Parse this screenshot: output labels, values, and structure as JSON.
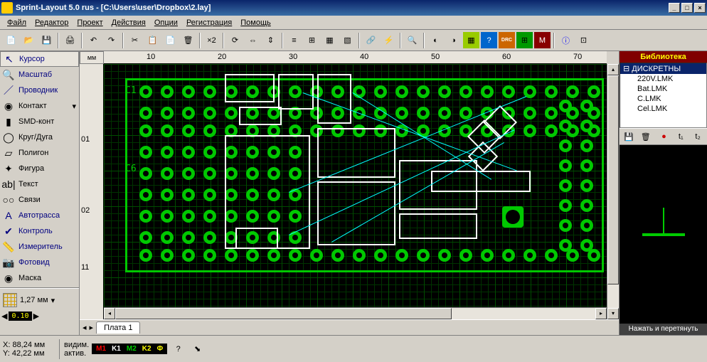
{
  "window": {
    "title": "Sprint-Layout 5.0 rus    - [C:\\Users\\user\\Dropbox\\2.lay]",
    "min": "_",
    "max": "□",
    "close": "×"
  },
  "menu": [
    "Файл",
    "Редактор",
    "Проект",
    "Действия",
    "Опции",
    "Регистрация",
    "Помощь"
  ],
  "tools": [
    {
      "id": "cursor",
      "label": "Курсор",
      "icon": "↖",
      "active": true,
      "navy": true
    },
    {
      "id": "zoom",
      "label": "Масштаб",
      "icon": "🔍",
      "navy": true
    },
    {
      "id": "track",
      "label": "Проводник",
      "icon": "／",
      "navy": true
    },
    {
      "id": "pad",
      "label": "Контакт",
      "icon": "◉",
      "arrow": true
    },
    {
      "id": "smd",
      "label": "SMD-конт",
      "icon": "▮"
    },
    {
      "id": "circle",
      "label": "Круг/Дуга",
      "icon": "◯"
    },
    {
      "id": "poly",
      "label": "Полигон",
      "icon": "▱"
    },
    {
      "id": "shape",
      "label": "Фигура",
      "icon": "✦"
    },
    {
      "id": "text",
      "label": "Текст",
      "icon": "ab|"
    },
    {
      "id": "conn",
      "label": "Связи",
      "icon": "○○"
    },
    {
      "id": "auto",
      "label": "Автотрасса",
      "icon": "A",
      "navy": true
    },
    {
      "id": "check",
      "label": "Контроль",
      "icon": "✔",
      "navy": true
    },
    {
      "id": "meas",
      "label": "Измеритель",
      "icon": "📏",
      "navy": true
    },
    {
      "id": "photo",
      "label": "Фотовид",
      "icon": "📷",
      "navy": true
    },
    {
      "id": "mask",
      "label": "Маска",
      "icon": "◉"
    }
  ],
  "grid": {
    "value": "1,27 мм"
  },
  "zoom": {
    "value": "0.10"
  },
  "ruler": {
    "unit": "мм",
    "hmarks": [
      "10",
      "20",
      "30",
      "40",
      "50",
      "60",
      "70"
    ],
    "vmarks": [
      "01",
      "02",
      "11"
    ]
  },
  "labels": {
    "c1": "C1",
    "c6": "C6"
  },
  "tab": "Плата 1",
  "library": {
    "title": "Библиотека",
    "root": "ДИСКРЕТНЫ",
    "items": [
      "220V.LMK",
      "Bat.LMK",
      "C.LMK",
      "Cel.LMK"
    ]
  },
  "preview_hint": "Нажать и перетянуть",
  "status": {
    "x": "X:  88,24 мм",
    "y": "Y:  42,22 мм",
    "vis": "видим.",
    "act": "актив.",
    "layers": {
      "m1": "M1",
      "k1": "K1",
      "m2": "M2",
      "k2": "K2",
      "f": "Ф"
    }
  }
}
